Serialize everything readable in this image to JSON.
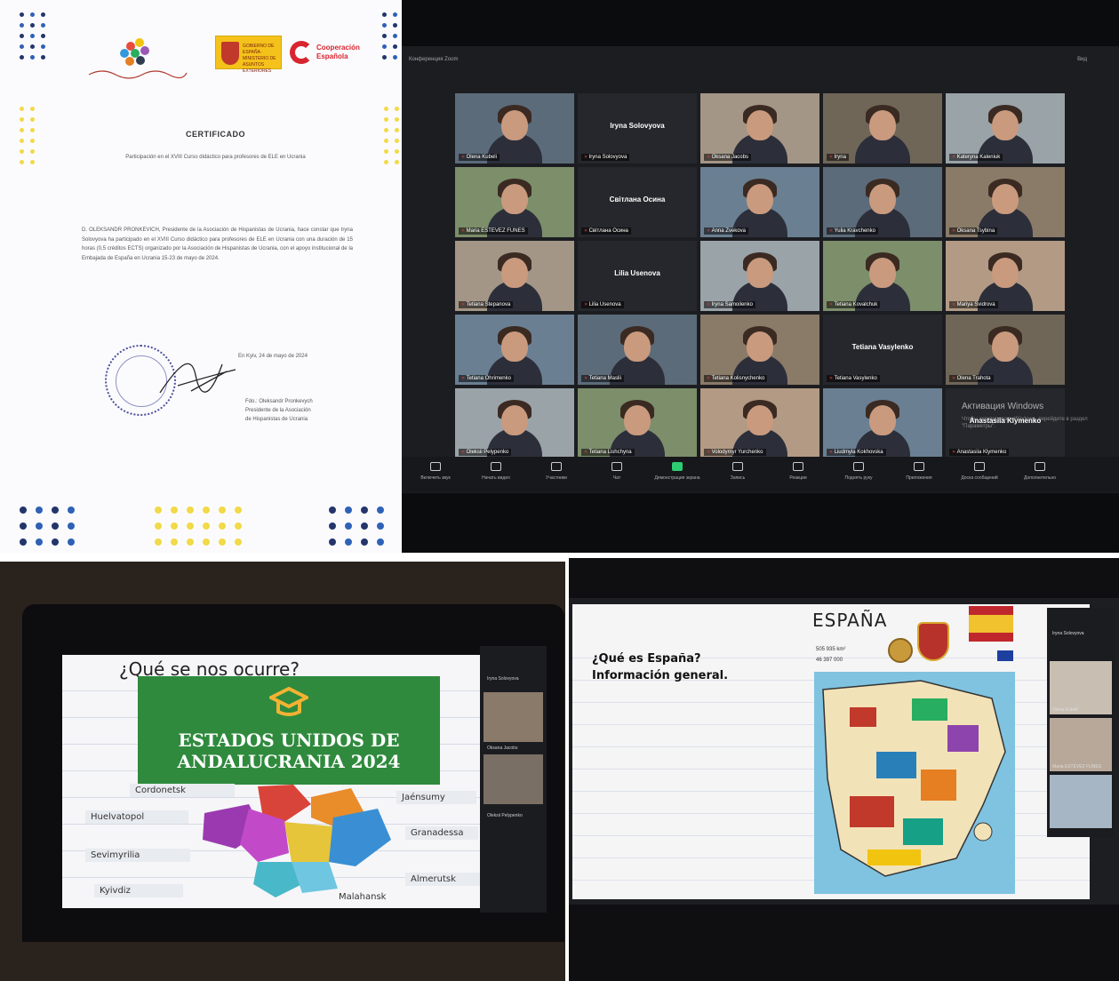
{
  "certificate": {
    "association_logo_text": "Asociación de Hispanistas de Ucrania",
    "gov_logo_text": "GOBIERNO DE ESPAÑA · MINISTERIO DE ASUNTOS EXTERIORES",
    "coop_logo_text": "Cooperación Española",
    "title": "CERTIFICADO",
    "subtitle": "Participación en el XVIII Curso didáctico para profesores de ELE en Ucrania",
    "body": "D. OLEKSANDR PRONKEVICH, Presidente de la Asociación de Hispanistas de Ucrania, hace constar que Iryna Solovyova ha participado en el XVIII Curso didáctico para profesores de ELE en Ucrania con una duración de 15 horas (0,5 créditos ECTS) organizado por la Asociación de Hispanistas de Ucrania, con el apoyo institucional de la Embajada de España en Ucrania 15-23 de mayo de 2024.",
    "date": "En Kyiv, 24 de mayo de 2024",
    "signer": "Fdo.: Oleksandr Pronkevych\nPresidente de la Asociación\nde Hispanistas de Ucrania"
  },
  "zoom": {
    "window_title": "Конференция Zoom",
    "top_right": "Вид",
    "participants": [
      {
        "name": "Olena Kubeli",
        "shown": "video"
      },
      {
        "name": "Iryna Solovyova",
        "shown": "name"
      },
      {
        "name": "Oksana Jacobs",
        "shown": "video"
      },
      {
        "name": "Iryna",
        "shown": "video"
      },
      {
        "name": "Kateryna Kaleniuk",
        "shown": "video"
      },
      {
        "name": "Maria ESTÉVEZ FUNES",
        "shown": "video"
      },
      {
        "name": "Світлана Осина",
        "shown": "name"
      },
      {
        "name": "Anna Zvekova",
        "shown": "video"
      },
      {
        "name": "Yulia Kravchenko",
        "shown": "video"
      },
      {
        "name": "Oksana Tsybina",
        "shown": "video"
      },
      {
        "name": "Tetiana Stepanova",
        "shown": "video"
      },
      {
        "name": "Lilia Usenova",
        "shown": "name"
      },
      {
        "name": "Iryna Samoilenko",
        "shown": "video"
      },
      {
        "name": "Tetiana Kovalchuk",
        "shown": "video"
      },
      {
        "name": "Mariya Svidrova",
        "shown": "video"
      },
      {
        "name": "Tetiana Ohrimenko",
        "shown": "video"
      },
      {
        "name": "Tetiana Maslii",
        "shown": "video"
      },
      {
        "name": "Tetiana Kolisnychenko",
        "shown": "video"
      },
      {
        "name": "Tetiana Vasylenko",
        "shown": "name"
      },
      {
        "name": "Olena Trahota",
        "shown": "video"
      },
      {
        "name": "Oleksii Pelypenko",
        "shown": "video"
      },
      {
        "name": "Tetiana Lishchyna",
        "shown": "video"
      },
      {
        "name": "Volodymyr Yurchenko",
        "shown": "video"
      },
      {
        "name": "Liudmyla Kokhovska",
        "shown": "video"
      },
      {
        "name": "Anastasiia Klymenko",
        "shown": "name"
      }
    ],
    "watermark": "Активация Windows",
    "watermark_sub": "Чтобы активировать Windows, перейдите в раздел \"Параметры\".",
    "toolbar": [
      "Включить звук",
      "Начать видео",
      "Участники",
      "Чат",
      "Демонстрация экрана",
      "Запись",
      "Реакции",
      "Поднять руку",
      "Приложения",
      "Доска сообщений",
      "Дополнительно"
    ]
  },
  "andalucrania": {
    "question": "¿Qué se nos ocurre?",
    "banner_title": "ESTADOS UNIDOS DE ANDALUCRANIA 2024",
    "cities": [
      "Cordonetsk",
      "Huelvatopol",
      "Jaénsumy",
      "Granadessa",
      "Sevimyrilia",
      "Kyivdiz",
      "Almerutsk",
      "Malahansk"
    ],
    "side_names": [
      "Iryna Solovyova",
      "Oksana Jacobs",
      "Oleksii Pelypenko"
    ],
    "colors": {
      "green": "#2f8a3d",
      "orange": "#e98c2a",
      "purple": "#9b3ab0",
      "red": "#d9443a",
      "blue": "#3a8fd4",
      "yellow": "#e6c53a",
      "teal": "#49b8c9"
    }
  },
  "espana": {
    "title": "ESPAÑA",
    "question_line1": "¿Qué es España?",
    "question_line2": "Información general.",
    "fact1": "505 935 km²",
    "fact2": "46 397 000",
    "side_names": [
      "Iryna Solovyova",
      "Olena Kubeli",
      "Maria ESTÉVEZ FUNES"
    ]
  }
}
